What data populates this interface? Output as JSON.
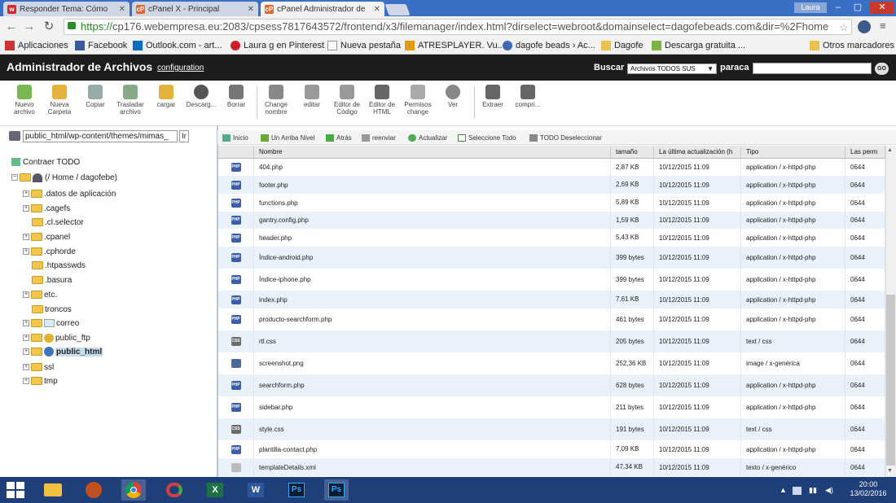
{
  "browser": {
    "tabs": [
      {
        "label": "Responder Tema: Cómo",
        "favicon": "w",
        "color": "#d9262c"
      },
      {
        "label": "cPanel X - Principal",
        "favicon": "cP",
        "color": "#e8632b"
      },
      {
        "label": "cPanel Administrador de",
        "favicon": "cP",
        "color": "#e8632b"
      }
    ],
    "user": "Laura",
    "url_proto": "https://",
    "url_rest": "cp176.webempresa.eu:2083/cpsess7817643572/frontend/x3/filemanager/index.html?dirselect=webroot&domainselect=dagofebeads.com&dir=%2Fhome",
    "bookmarks": [
      {
        "label": "Aplicaciones",
        "color": "#c33"
      },
      {
        "label": "Facebook",
        "color": "#3b5998"
      },
      {
        "label": "Outlook.com - art...",
        "color": "#0a6fc2"
      },
      {
        "label": "Laura g en Pinterest",
        "color": "#cb2027"
      },
      {
        "label": "Nueva pestaña",
        "color": "#999"
      },
      {
        "label": "ATRESPLAYER. Vu...",
        "color": "#e39b17"
      },
      {
        "label": "dagofe beads › Ac...",
        "color": "#3f6ab3"
      },
      {
        "label": "Dagofe",
        "color": "#e8c14a"
      },
      {
        "label": "Descarga gratuita ...",
        "color": "#7cb342"
      }
    ],
    "other_bookmarks": "Otros marcadores"
  },
  "app": {
    "title": "Administrador de Archivos",
    "config_link": "configuration",
    "search_label": "Buscar",
    "search_scope": "Archivos TODOS SUS",
    "para_label": "paraca",
    "go_label": "GO"
  },
  "toolbar": [
    {
      "label": "Nuevo archivo",
      "color": "#7ab852"
    },
    {
      "label": "Nueva Carpeta",
      "color": "#e3b23c"
    },
    {
      "label": "Copiar",
      "color": "#9aa"
    },
    {
      "label": "Trasladar archivo",
      "color": "#8a8"
    },
    {
      "label": "cargar",
      "color": "#e3b23c"
    },
    {
      "label": "Descarg...",
      "color": "#555"
    },
    {
      "label": "Borrar",
      "color": "#777"
    },
    {
      "label": "Change nombre",
      "color": "#888"
    },
    {
      "label": "editar",
      "color": "#999"
    },
    {
      "label": "Editor de Código",
      "color": "#999"
    },
    {
      "label": "Editor de HTML",
      "color": "#666"
    },
    {
      "label": "Permisos change",
      "color": "#aaa"
    },
    {
      "label": "Ver",
      "color": "#888"
    },
    {
      "label": "Extraer",
      "color": "#666"
    },
    {
      "label": "compri...",
      "color": "#666"
    }
  ],
  "path": {
    "value": "public_html/wp-content/themes/mimas_",
    "go": "Ir"
  },
  "tree": {
    "collapse_label": "Contraer TODO",
    "root": "(/ Home / dagofebe)",
    "items": [
      {
        "label": ".datos de aplicación",
        "expand": true
      },
      {
        "label": ".cagefs",
        "expand": true
      },
      {
        "label": ".cl.selector",
        "expand": false
      },
      {
        "label": ".cpanel",
        "expand": true
      },
      {
        "label": ".cphorde",
        "expand": true
      },
      {
        "label": ".htpasswds",
        "expand": false
      },
      {
        "label": ".basura",
        "expand": false
      },
      {
        "label": "etc.",
        "expand": true
      },
      {
        "label": "troncos",
        "expand": false
      },
      {
        "label": "correo",
        "expand": true
      },
      {
        "label": "public_ftp",
        "expand": true
      },
      {
        "label": "public_html",
        "expand": true,
        "selected": true
      },
      {
        "label": "ssl",
        "expand": true
      },
      {
        "label": "tmp",
        "expand": true
      }
    ]
  },
  "nav": [
    {
      "label": "Inicio",
      "color": "#5a8"
    },
    {
      "label": "Un Arriba Nivel",
      "color": "#6a3"
    },
    {
      "label": "Atrás",
      "color": "#4a4"
    },
    {
      "label": "reenviar",
      "color": "#999"
    },
    {
      "label": "Actualizar",
      "color": "#5a5"
    },
    {
      "label": "Seleccione Todo",
      "color": "#484"
    },
    {
      "label": "TODO Deseleccionar",
      "color": "#888"
    }
  ],
  "table": {
    "columns": [
      "Nombre",
      "tamaño",
      "La última actualización (h",
      "Tipo",
      "Las perm"
    ],
    "rows": [
      {
        "name": "404.php",
        "size": "2,87 KB",
        "date": "10/12/2015 11:09",
        "type": "application / x-httpd-php",
        "perm": "0644",
        "icon": "php"
      },
      {
        "name": "footer.php",
        "size": "2,69 KB",
        "date": "10/12/2015 11:09",
        "type": "application / x-httpd-php",
        "perm": "0644",
        "icon": "php"
      },
      {
        "name": "functions.php",
        "size": "5,89 KB",
        "date": "10/12/2015 11:09",
        "type": "application / x-httpd-php",
        "perm": "0644",
        "icon": "php"
      },
      {
        "name": "gantry.config.php",
        "size": "1,59 KB",
        "date": "10/12/2015 11:09",
        "type": "application / x-httpd-php",
        "perm": "0644",
        "icon": "php"
      },
      {
        "name": "header.php",
        "size": "5,43 KB",
        "date": "10/12/2015 11:09",
        "type": "application / x-httpd-php",
        "perm": "0644",
        "icon": "php"
      },
      {
        "name": "Índice-android.php",
        "size": "399 bytes",
        "date": "10/12/2015 11:09",
        "type": "application / x-httpd-php",
        "perm": "0644",
        "icon": "php"
      },
      {
        "name": "Índice-iphone.php",
        "size": "399 bytes",
        "date": "10/12/2015 11:09",
        "type": "application / x-httpd-php",
        "perm": "0644",
        "icon": "php"
      },
      {
        "name": "index.php",
        "size": "7,61 KB",
        "date": "10/12/2015 11:09",
        "type": "application / x-httpd-php",
        "perm": "0644",
        "icon": "php"
      },
      {
        "name": "producto-searchform.php",
        "size": "461 bytes",
        "date": "10/12/2015 11:09",
        "type": "application / x-httpd-php",
        "perm": "0644",
        "icon": "php"
      },
      {
        "name": "rtl.css",
        "size": "205 bytes",
        "date": "10/12/2015 11:09",
        "type": "text / css",
        "perm": "0644",
        "icon": "css"
      },
      {
        "name": "screenshot.png",
        "size": "252,36 KB",
        "date": "10/12/2015 11:09",
        "type": "image / x-genérica",
        "perm": "0644",
        "icon": "img"
      },
      {
        "name": "searchform.php",
        "size": "628 bytes",
        "date": "10/12/2015 11:09",
        "type": "application / x-httpd-php",
        "perm": "0644",
        "icon": "php"
      },
      {
        "name": "sidebar.php",
        "size": "211 bytes",
        "date": "10/12/2015 11:09",
        "type": "application / x-httpd-php",
        "perm": "0644",
        "icon": "php"
      },
      {
        "name": "style.css",
        "size": "191 bytes",
        "date": "10/12/2015 11:09",
        "type": "text / css",
        "perm": "0644",
        "icon": "css"
      },
      {
        "name": "plantilla-contact.php",
        "size": "7,09 KB",
        "date": "10/12/2015 11:09",
        "type": "application / x-httpd-php",
        "perm": "0644",
        "icon": "php"
      },
      {
        "name": "templateDetails.xml",
        "size": "47,34 KB",
        "date": "10/12/2015 11:09",
        "type": "texto / x-genérico",
        "perm": "0644",
        "icon": "txt"
      }
    ]
  },
  "taskbar": {
    "apps": [
      {
        "name": "file-explorer-icon",
        "color": "#f0c040"
      },
      {
        "name": "baseball-glove-icon",
        "color": "#c0501e"
      },
      {
        "name": "chrome-icon",
        "color": "#4caf50",
        "active": true
      },
      {
        "name": "app-swirl-icon",
        "color": "#d04040"
      },
      {
        "name": "excel-icon",
        "color": "#1e7145"
      },
      {
        "name": "word-icon",
        "color": "#2b579a"
      },
      {
        "name": "photoshop-icon",
        "color": "#001d34"
      },
      {
        "name": "photoshop-icon-2",
        "color": "#001d34"
      }
    ],
    "ps_label": "Ps",
    "time": "20:00",
    "date": "13/02/2016"
  }
}
